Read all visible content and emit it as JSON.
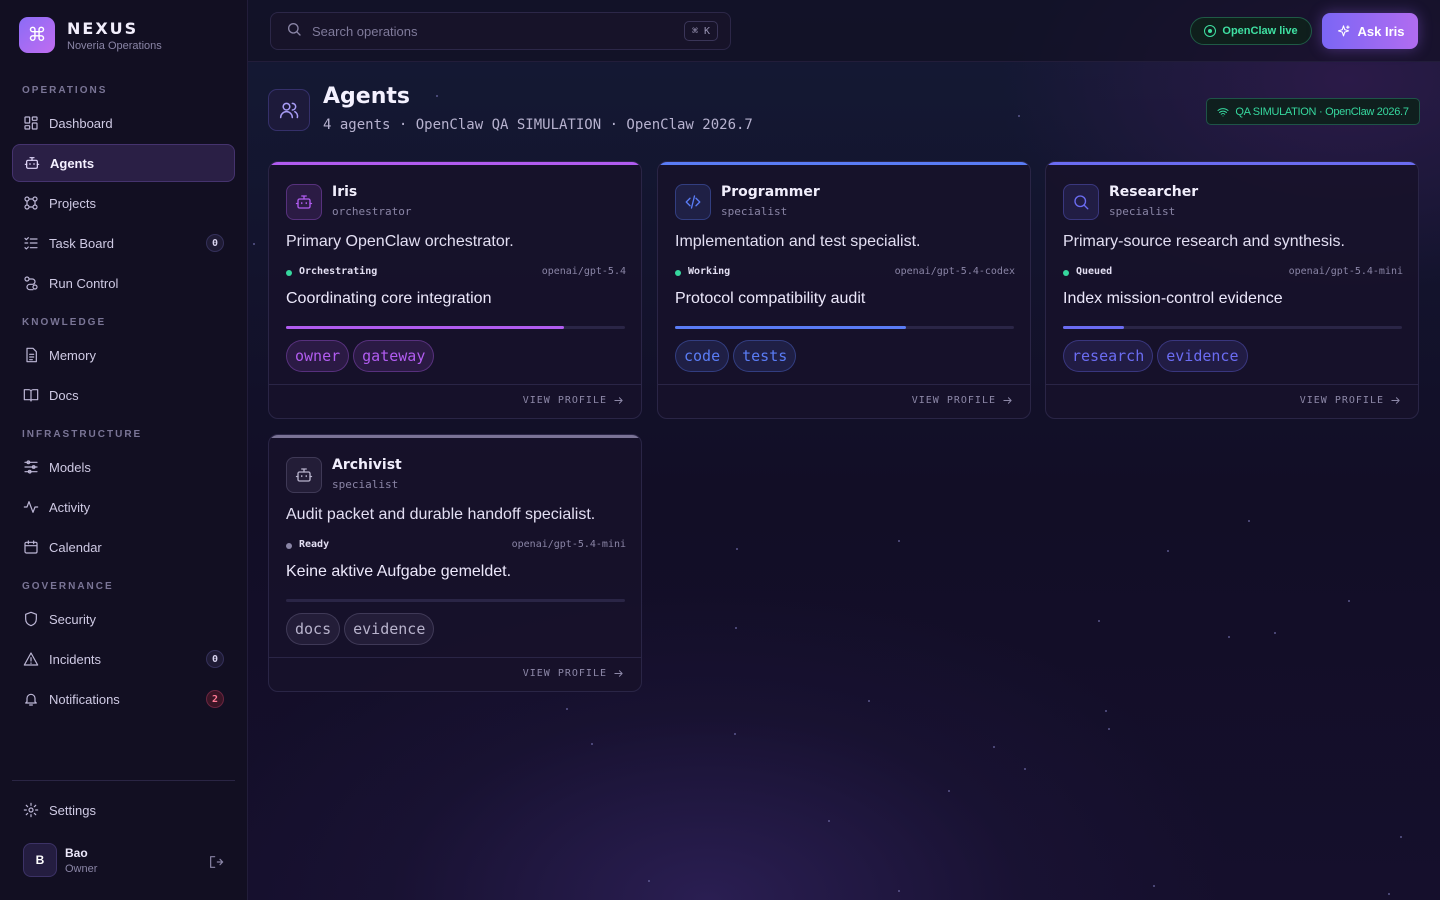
{
  "brand": {
    "name": "NEXUS",
    "subtitle": "Noveria Operations",
    "logo_icon": "command-icon"
  },
  "sidebar": {
    "sections": [
      {
        "title": "OPERATIONS",
        "items": [
          {
            "label": "Dashboard",
            "icon": "dashboard-icon"
          },
          {
            "label": "Agents",
            "icon": "robot-icon",
            "active": true
          },
          {
            "label": "Projects",
            "icon": "projects-icon"
          },
          {
            "label": "Task Board",
            "icon": "tasklist-icon",
            "badge": "0"
          },
          {
            "label": "Run Control",
            "icon": "route-icon"
          }
        ]
      },
      {
        "title": "KNOWLEDGE",
        "items": [
          {
            "label": "Memory",
            "icon": "memory-icon"
          },
          {
            "label": "Docs",
            "icon": "book-icon"
          }
        ]
      },
      {
        "title": "INFRASTRUCTURE",
        "items": [
          {
            "label": "Models",
            "icon": "sliders-icon"
          },
          {
            "label": "Activity",
            "icon": "activity-icon"
          },
          {
            "label": "Calendar",
            "icon": "calendar-icon"
          }
        ]
      },
      {
        "title": "GOVERNANCE",
        "items": [
          {
            "label": "Security",
            "icon": "shield-icon"
          },
          {
            "label": "Incidents",
            "icon": "warning-icon",
            "badge": "0"
          },
          {
            "label": "Notifications",
            "icon": "bell-icon",
            "badge": "2"
          }
        ]
      }
    ],
    "settings": {
      "label": "Settings",
      "icon": "gear-icon"
    },
    "user": {
      "initial": "B",
      "name": "Bao",
      "role": "Owner"
    }
  },
  "topbar": {
    "search_placeholder": "Search operations",
    "search_shortcut": "⌘ K",
    "live_status": "OpenClaw live",
    "ask_button": "Ask Iris"
  },
  "page": {
    "title": "Agents",
    "subtitle": "4 agents · OpenClaw QA SIMULATION · OpenClaw 2026.7",
    "sim_badge": "QA SIMULATION · OpenClaw 2026.7"
  },
  "agents": [
    {
      "name": "Iris",
      "role": "orchestrator",
      "icon": "robot-icon",
      "description": "Primary OpenClaw orchestrator.",
      "status": "Orchestrating",
      "model": "openai/gpt-5.4",
      "task": "Coordinating core integration",
      "progress": 0.82,
      "tags": [
        "owner",
        "gateway"
      ],
      "accent": "#b15cf0",
      "view_label": "VIEW PROFILE"
    },
    {
      "name": "Programmer",
      "role": "specialist",
      "icon": "code-icon",
      "description": "Implementation and test specialist.",
      "status": "Working",
      "model": "openai/gpt-5.4-codex",
      "task": "Protocol compatibility audit",
      "progress": 0.68,
      "tags": [
        "code",
        "tests"
      ],
      "accent": "#5a7cf5",
      "view_label": "VIEW PROFILE"
    },
    {
      "name": "Researcher",
      "role": "specialist",
      "icon": "search-icon",
      "description": "Primary-source research and synthesis.",
      "status": "Queued",
      "model": "openai/gpt-5.4-mini",
      "task": "Index mission-control evidence",
      "progress": 0.18,
      "tags": [
        "research",
        "evidence"
      ],
      "accent": "#6b6cf2",
      "view_label": "VIEW PROFILE"
    },
    {
      "name": "Archivist",
      "role": "specialist",
      "icon": "robot-icon",
      "description": "Audit packet and durable handoff specialist.",
      "status": "Ready",
      "model": "openai/gpt-5.4-mini",
      "task": "Keine aktive Aufgabe gemeldet.",
      "progress": 0,
      "tags": [
        "docs",
        "evidence"
      ],
      "accent": "#7a7396",
      "view_label": "VIEW PROFILE"
    }
  ]
}
